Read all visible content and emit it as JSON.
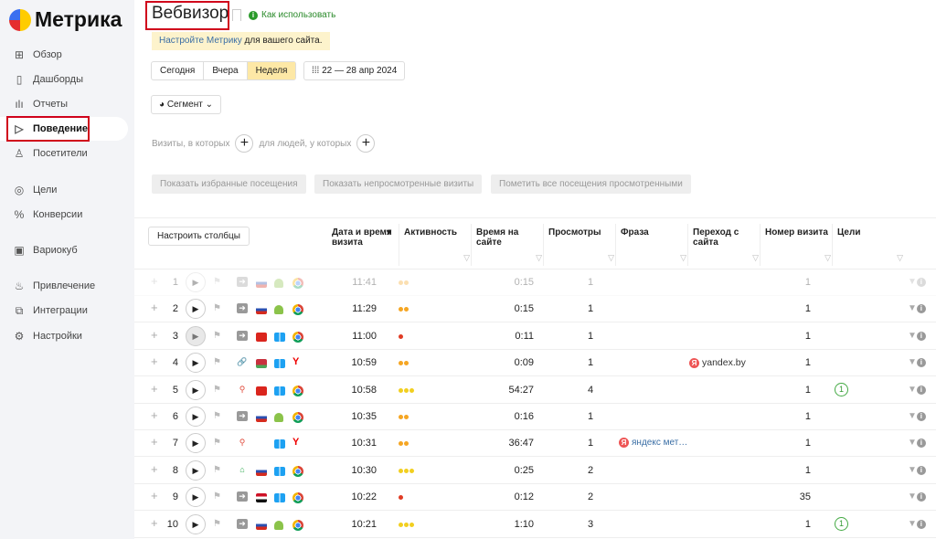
{
  "app": {
    "logo_text": "Метрика"
  },
  "sidebar": {
    "items": [
      {
        "label": "Обзор",
        "icon": "grid-icon",
        "glyph": "⊞"
      },
      {
        "label": "Дашборды",
        "icon": "dashboards-icon",
        "glyph": "▯"
      },
      {
        "label": "Отчеты",
        "icon": "bar-chart-icon",
        "glyph": "ılı"
      },
      {
        "label": "Поведение",
        "icon": "play-outline-icon",
        "glyph": "▷",
        "active": true
      },
      {
        "label": "Посетители",
        "icon": "user-icon",
        "glyph": "♙"
      },
      {
        "label": "Цели",
        "icon": "target-icon",
        "glyph": "◎"
      },
      {
        "label": "Конверсии",
        "icon": "percent-icon",
        "glyph": "%"
      },
      {
        "label": "Вариокуб",
        "icon": "variocube-icon",
        "glyph": "▣"
      },
      {
        "label": "Привлечение",
        "icon": "flame-icon",
        "glyph": "♨"
      },
      {
        "label": "Интеграции",
        "icon": "puzzle-icon",
        "glyph": "⧉"
      },
      {
        "label": "Настройки",
        "icon": "gear-icon",
        "glyph": "⚙"
      }
    ]
  },
  "header": {
    "title": "Вебвизор",
    "howto": "Как использовать",
    "notice_link": "Настройте Метрику",
    "notice_rest": " для вашего сайта."
  },
  "period": {
    "options": [
      "Сегодня",
      "Вчера",
      "Неделя"
    ],
    "selected": "Неделя",
    "range": "22 — 28 апр 2024"
  },
  "segment_label": "Сегмент",
  "filters": {
    "visits": "Визиты, в которых",
    "people": "для людей, у которых"
  },
  "actions": [
    "Показать избранные посещения",
    "Показать непросмотренные визиты",
    "Пометить все посещения просмотренными"
  ],
  "table": {
    "configure_label": "Настроить столбцы",
    "columns": [
      "Дата и время визита",
      "Активность",
      "Время на сайте",
      "Просмотры",
      "Фраза",
      "Переход с сайта",
      "Номер визита",
      "Цели"
    ],
    "colors": {
      "orange": "#f5a623",
      "yellow": "#f2cf1f",
      "red": "#e03b24"
    },
    "rows": [
      {
        "n": "1",
        "time": "11:41",
        "act": 2,
        "actc": "orange",
        "dur": "0:15",
        "views": "1",
        "phrase": "",
        "ref": "",
        "vn": "1",
        "goal": "",
        "src": "direct",
        "flag": "ru",
        "os": "android",
        "br": "chrome",
        "faded": true
      },
      {
        "n": "2",
        "time": "11:29",
        "act": 2,
        "actc": "orange",
        "dur": "0:15",
        "views": "1",
        "phrase": "",
        "ref": "",
        "vn": "1",
        "goal": "",
        "src": "direct",
        "flag": "ru",
        "os": "android",
        "br": "chrome"
      },
      {
        "n": "3",
        "time": "11:00",
        "act": 1,
        "actc": "red",
        "dur": "0:11",
        "views": "1",
        "phrase": "",
        "ref": "",
        "vn": "1",
        "goal": "",
        "src": "direct",
        "flag": "vn",
        "os": "windows",
        "br": "chrome",
        "hover": true
      },
      {
        "n": "4",
        "time": "10:59",
        "act": 2,
        "actc": "orange",
        "dur": "0:09",
        "views": "1",
        "phrase": "",
        "ref": "yandex.by",
        "vn": "1",
        "goal": "",
        "src": "link",
        "flag": "by",
        "os": "windows",
        "br": "yandex"
      },
      {
        "n": "5",
        "time": "10:58",
        "act": 3,
        "actc": "yellow",
        "dur": "54:27",
        "views": "4",
        "phrase": "",
        "ref": "",
        "vn": "1",
        "goal": "1",
        "src": "search",
        "flag": "vn",
        "os": "windows",
        "br": "chrome"
      },
      {
        "n": "6",
        "time": "10:35",
        "act": 2,
        "actc": "orange",
        "dur": "0:16",
        "views": "1",
        "phrase": "",
        "ref": "",
        "vn": "1",
        "goal": "",
        "src": "direct",
        "flag": "ru",
        "os": "android",
        "br": "chrome"
      },
      {
        "n": "7",
        "time": "10:31",
        "act": 2,
        "actc": "orange",
        "dur": "36:47",
        "views": "1",
        "phrase": "яндекс мет…",
        "ref": "",
        "vn": "1",
        "goal": "",
        "src": "search",
        "flag": "ge",
        "os": "windows",
        "br": "yandex"
      },
      {
        "n": "8",
        "time": "10:30",
        "act": 3,
        "actc": "yellow",
        "dur": "0:25",
        "views": "2",
        "phrase": "",
        "ref": "",
        "vn": "1",
        "goal": "",
        "src": "internal",
        "flag": "ru",
        "os": "windows",
        "br": "chrome"
      },
      {
        "n": "9",
        "time": "10:22",
        "act": 1,
        "actc": "red",
        "dur": "0:12",
        "views": "2",
        "phrase": "",
        "ref": "",
        "vn": "35",
        "goal": "",
        "src": "direct",
        "flag": "eg",
        "os": "windows",
        "br": "chrome"
      },
      {
        "n": "10",
        "time": "10:21",
        "act": 3,
        "actc": "yellow",
        "dur": "1:10",
        "views": "3",
        "phrase": "",
        "ref": "",
        "vn": "1",
        "goal": "1",
        "src": "direct",
        "flag": "ru",
        "os": "android",
        "br": "chrome"
      }
    ]
  }
}
